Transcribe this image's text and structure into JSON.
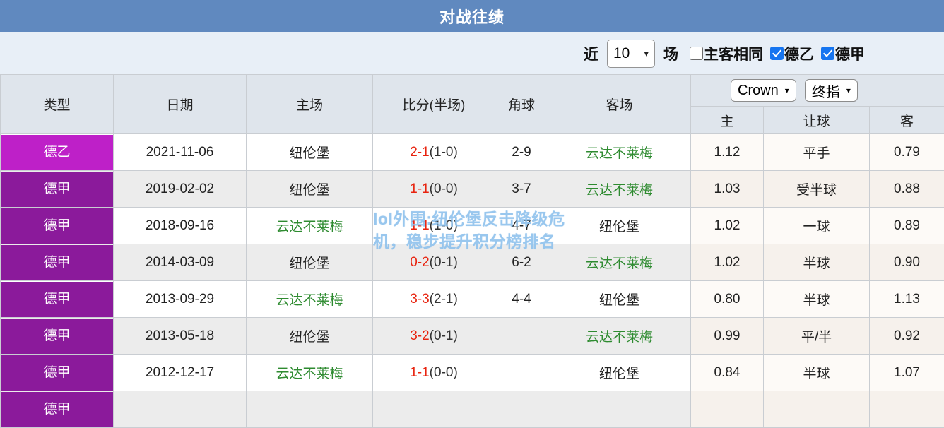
{
  "header": {
    "title": "对战往绩",
    "bg_color": "#6089bf"
  },
  "filters": {
    "recent_label": "近",
    "count_value": "10",
    "matches_label": "场",
    "same_venue_label": "主客相同",
    "same_venue_checked": false,
    "league2_label": "德乙",
    "league2_checked": true,
    "league1_label": "德甲",
    "league1_checked": true,
    "caret": "⌄"
  },
  "odds_pickers": {
    "company": "Crown",
    "stage": "终指",
    "caret": "⌄"
  },
  "table": {
    "headers": {
      "type": "类型",
      "date": "日期",
      "home": "主场",
      "score": "比分(半场)",
      "corner": "角球",
      "away": "客场",
      "odds_home": "主",
      "odds_handicap": "让球",
      "odds_away": "客"
    },
    "rows": [
      {
        "type": "德乙",
        "type_class": "d2",
        "date": "2021-11-06",
        "home": "纽伦堡",
        "home_color": "dark",
        "score_main": "2-1",
        "score_half": "(1-0)",
        "corner": "2-9",
        "away": "云达不莱梅",
        "away_color": "green",
        "odds_home": "1.12",
        "odds_handicap": "平手",
        "odds_away": "0.79"
      },
      {
        "type": "德甲",
        "type_class": "d1",
        "date": "2019-02-02",
        "home": "纽伦堡",
        "home_color": "dark",
        "score_main": "1-1",
        "score_half": "(0-0)",
        "corner": "3-7",
        "away": "云达不莱梅",
        "away_color": "green",
        "odds_home": "1.03",
        "odds_handicap": "受半球",
        "odds_away": "0.88"
      },
      {
        "type": "德甲",
        "type_class": "d1",
        "date": "2018-09-16",
        "home": "云达不莱梅",
        "home_color": "green",
        "score_main": "1-1",
        "score_half": "(1-0)",
        "corner": "4-7",
        "away": "纽伦堡",
        "away_color": "dark",
        "odds_home": "1.02",
        "odds_handicap": "一球",
        "odds_away": "0.89"
      },
      {
        "type": "德甲",
        "type_class": "d1",
        "date": "2014-03-09",
        "home": "纽伦堡",
        "home_color": "dark",
        "score_main": "0-2",
        "score_half": "(0-1)",
        "corner": "6-2",
        "away": "云达不莱梅",
        "away_color": "green",
        "odds_home": "1.02",
        "odds_handicap": "半球",
        "odds_away": "0.90"
      },
      {
        "type": "德甲",
        "type_class": "d1",
        "date": "2013-09-29",
        "home": "云达不莱梅",
        "home_color": "green",
        "score_main": "3-3",
        "score_half": "(2-1)",
        "corner": "4-4",
        "away": "纽伦堡",
        "away_color": "dark",
        "odds_home": "0.80",
        "odds_handicap": "半球",
        "odds_away": "1.13"
      },
      {
        "type": "德甲",
        "type_class": "d1",
        "date": "2013-05-18",
        "home": "纽伦堡",
        "home_color": "dark",
        "score_main": "3-2",
        "score_half": "(0-1)",
        "corner": "",
        "away": "云达不莱梅",
        "away_color": "green",
        "odds_home": "0.99",
        "odds_handicap": "平/半",
        "odds_away": "0.92"
      },
      {
        "type": "德甲",
        "type_class": "d1",
        "date": "2012-12-17",
        "home": "云达不莱梅",
        "home_color": "green",
        "score_main": "1-1",
        "score_half": "(0-0)",
        "corner": "",
        "away": "纽伦堡",
        "away_color": "dark",
        "odds_home": "0.84",
        "odds_handicap": "半球",
        "odds_away": "1.07"
      },
      {
        "type": "德甲",
        "type_class": "d1",
        "date": "",
        "home": "",
        "home_color": "dark",
        "score_main": "",
        "score_half": "",
        "corner": "",
        "away": "",
        "away_color": "dark",
        "odds_home": "",
        "odds_handicap": "",
        "odds_away": ""
      }
    ]
  },
  "watermark": {
    "text": "lol外围:纽伦堡反击降级危机，稳步提升积分榜排名",
    "color": "#8cc0ec"
  }
}
